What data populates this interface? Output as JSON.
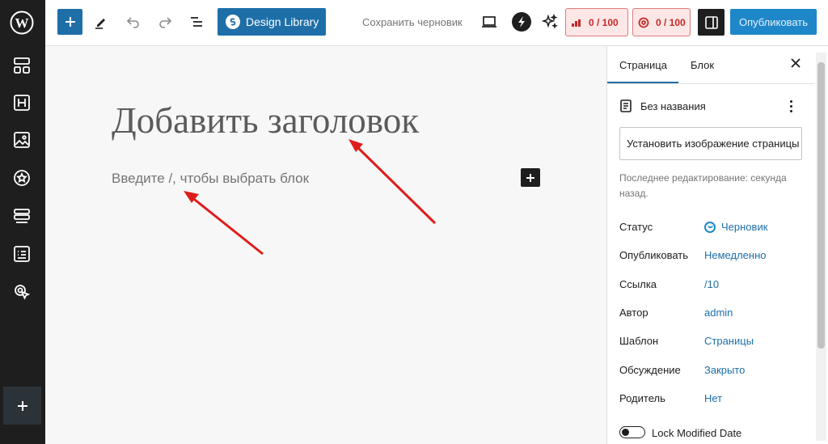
{
  "leftbar": {
    "icons": [
      "wordpress-logo",
      "layout-icon",
      "heading-icon",
      "image-icon",
      "star-icon",
      "rows-icon",
      "form-icon",
      "cursor-icon"
    ],
    "add_icon": "plus-icon"
  },
  "toolbar": {
    "design_library_label": "Design Library",
    "save_draft_label": "Сохранить черновик",
    "score1": "0 / 100",
    "score2": "0 / 100",
    "publish_label": "Опубликовать",
    "accent": "#1e6fa8"
  },
  "editor": {
    "title_placeholder": "Добавить заголовок",
    "block_placeholder": "Введите /, чтобы выбрать блок"
  },
  "panel": {
    "tabs": [
      {
        "label": "Страница"
      },
      {
        "label": "Блок"
      }
    ],
    "doc_title": "Без названия",
    "set_image_label": "Установить изображение страницы",
    "last_edited": "Последнее редактирование: секунда назад.",
    "rows": [
      {
        "label": "Статус",
        "value": "Черновик"
      },
      {
        "label": "Опубликовать",
        "value": "Немедленно"
      },
      {
        "label": "Ссылка",
        "value": "/10"
      },
      {
        "label": "Автор",
        "value": "admin"
      },
      {
        "label": "Шаблон",
        "value": "Страницы"
      },
      {
        "label": "Обсуждение",
        "value": "Закрыто"
      },
      {
        "label": "Родитель",
        "value": "Нет"
      }
    ],
    "toggle_label": "Lock Modified Date"
  }
}
